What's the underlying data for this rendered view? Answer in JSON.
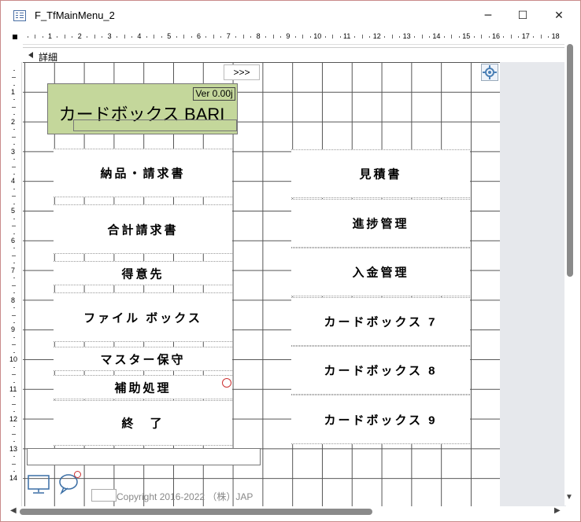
{
  "window": {
    "title": "F_TfMainMenu_2",
    "minimize": "─",
    "maximize": "☐",
    "close": "✕"
  },
  "ruler": {
    "h_numbers": [
      "1",
      "2",
      "3",
      "4",
      "5",
      "6",
      "7",
      "8",
      "9",
      "10",
      "11",
      "12",
      "13",
      "14",
      "15",
      "16",
      "17",
      "18"
    ],
    "v_numbers": [
      "1",
      "2",
      "3",
      "4",
      "5",
      "6",
      "7",
      "8",
      "9",
      "10",
      "11",
      "12",
      "13",
      "14"
    ]
  },
  "section": {
    "label": "詳細"
  },
  "form": {
    "version": "Ver 0.00j",
    "app_title": "カードボックス BARI",
    "nav_button": ">>>",
    "left_buttons": [
      "納品・請求書",
      "合計請求書",
      "得意先",
      "ファイル ボックス",
      "マスター保守",
      "補助処理",
      "終　了"
    ],
    "right_buttons": [
      "見積書",
      "進捗管理",
      "入金管理",
      "カードボックス 7",
      "カードボックス 8",
      "カードボックス 9"
    ],
    "copyright": "Copyright 2016-2022 （株）JAP"
  },
  "icons": {
    "app": "form-icon",
    "gear": "gear-icon",
    "pc": "computer-icon",
    "chat": "chat-bubble-icon",
    "section_arrow": "collapse-arrow-icon"
  },
  "colors": {
    "header_fill": "#c4d79b",
    "grid": "#555555",
    "gray_area": "#e6e8ec"
  }
}
